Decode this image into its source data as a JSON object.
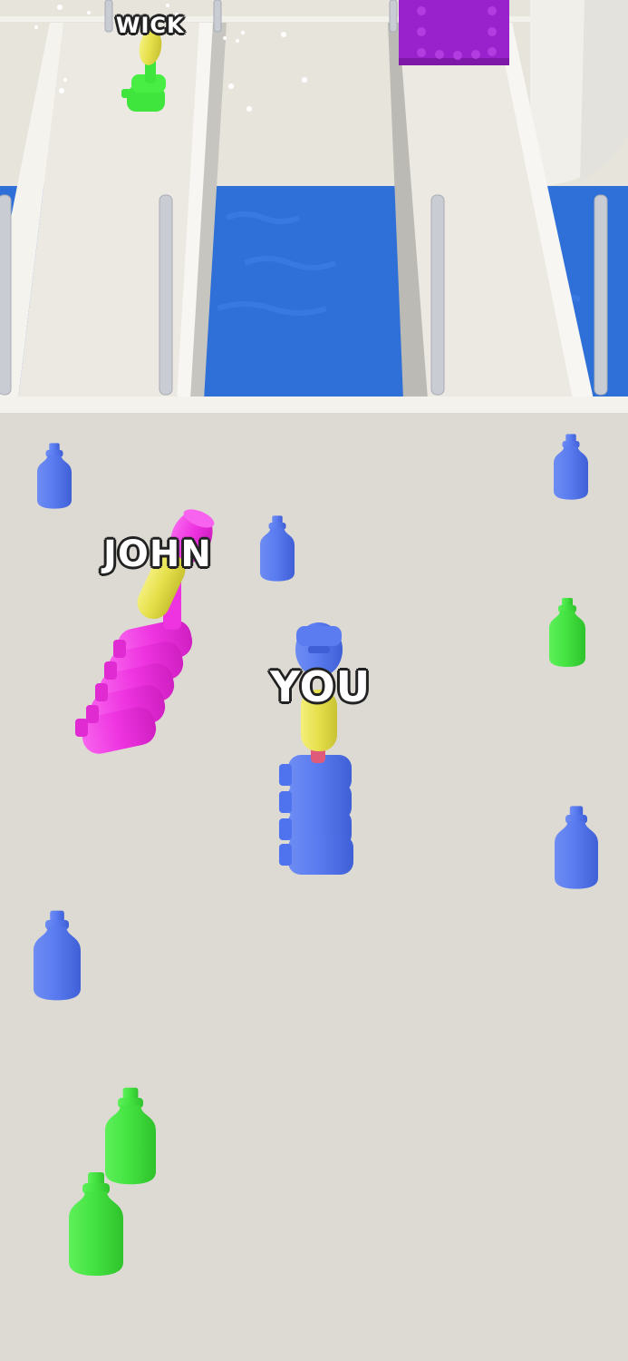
{
  "players": {
    "wick": {
      "name": "WICK",
      "color": "#3fe53d"
    },
    "john": {
      "name": "JOHN",
      "color": "#ee33e0"
    },
    "you": {
      "name": "YOU",
      "color": "#4f72ee"
    }
  },
  "colors": {
    "floor": "#dddad3",
    "water": "#2f6fd8",
    "bridge": "#ece9e2",
    "rail": "#c9ccd3",
    "obstacle": "#9a22cc",
    "held_bottle": "#e5df4a"
  },
  "pickups": [
    {
      "color": "blue",
      "icon": "bottle-icon"
    },
    {
      "color": "blue",
      "icon": "bottle-icon"
    },
    {
      "color": "blue",
      "icon": "bottle-icon"
    },
    {
      "color": "green",
      "icon": "bottle-icon"
    },
    {
      "color": "blue",
      "icon": "bottle-icon"
    },
    {
      "color": "blue",
      "icon": "bottle-icon"
    },
    {
      "color": "green",
      "icon": "bottle-icon"
    },
    {
      "color": "green",
      "icon": "bottle-icon"
    }
  ]
}
